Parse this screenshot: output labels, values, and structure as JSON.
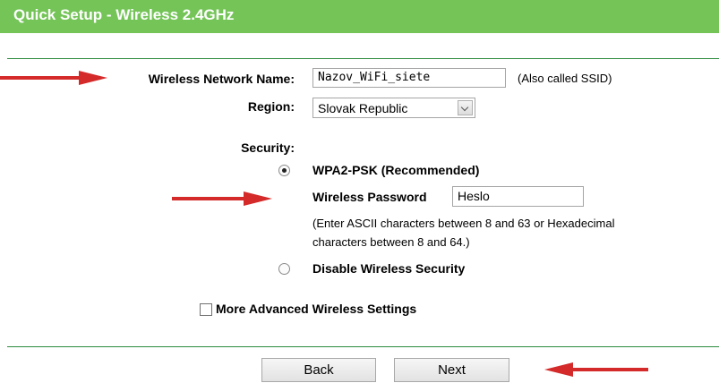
{
  "header": {
    "title": "Quick Setup - Wireless 2.4GHz"
  },
  "form": {
    "ssid_label": "Wireless Network Name:",
    "ssid_value": "Nazov_WiFi_siete",
    "ssid_hint": "(Also called SSID)",
    "region_label": "Region:",
    "region_value": "Slovak Republic",
    "security_label": "Security:",
    "wpa_label": "WPA2-PSK (Recommended)",
    "password_label": "Wireless Password",
    "password_value": "Heslo",
    "password_note_line1": "(Enter ASCII characters between 8 and 63 or Hexadecimal",
    "password_note_line2": "characters between 8 and 64.)",
    "disable_label": "Disable Wireless Security",
    "advanced_label": "More Advanced Wireless Settings"
  },
  "buttons": {
    "back": "Back",
    "next": "Next"
  },
  "colors": {
    "header_bg": "#74c458",
    "rule": "#2c8a3e",
    "arrow": "#d42a2a"
  },
  "state": {
    "security_selected": "WPA2-PSK",
    "advanced_checked": false
  }
}
